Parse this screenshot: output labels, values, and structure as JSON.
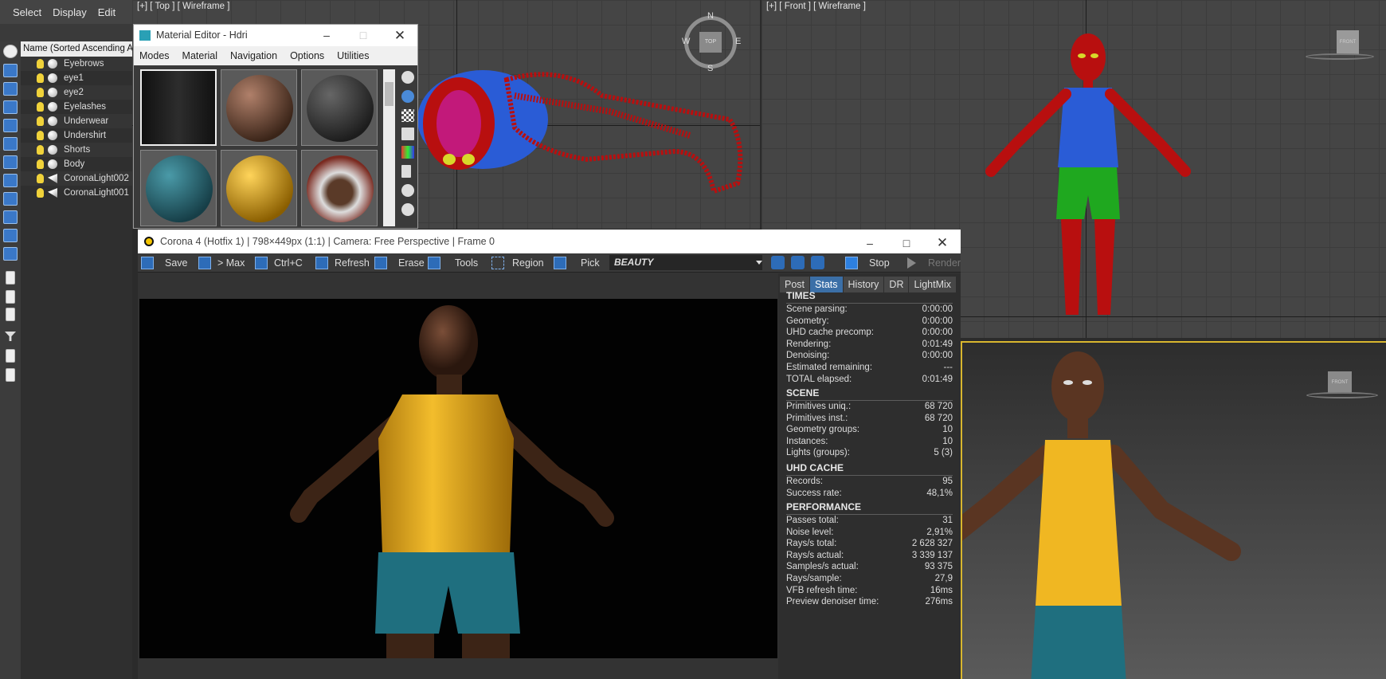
{
  "menubar": {
    "items": [
      "Select",
      "Display",
      "Edit"
    ]
  },
  "explorer": {
    "header": "Name (Sorted Ascending Ag",
    "items": [
      {
        "label": "Eyebrows",
        "kind": "object"
      },
      {
        "label": "eye1",
        "kind": "object"
      },
      {
        "label": "eye2",
        "kind": "object"
      },
      {
        "label": "Eyelashes",
        "kind": "object"
      },
      {
        "label": "Underwear",
        "kind": "object"
      },
      {
        "label": "Undershirt",
        "kind": "object"
      },
      {
        "label": "Shorts",
        "kind": "object"
      },
      {
        "label": "Body",
        "kind": "object"
      },
      {
        "label": "CoronaLight002",
        "kind": "light"
      },
      {
        "label": "CoronaLight001",
        "kind": "light"
      }
    ]
  },
  "viewports": {
    "top": {
      "label": "[+] [ Top ] [ Wireframe ]",
      "compass": {
        "n": "N",
        "s": "S",
        "e": "E",
        "w": "W",
        "cube": "TOP"
      }
    },
    "front": {
      "label": "[+] [ Front ] [ Wireframe ]",
      "cube": "FRONT"
    },
    "persp": {
      "cube": "FRONT"
    }
  },
  "material_editor": {
    "title": "Material Editor - Hdri",
    "menu": [
      "Modes",
      "Material",
      "Navigation",
      "Options",
      "Utilities"
    ]
  },
  "corona": {
    "title": "Corona 4 (Hotfix 1) | 798×449px (1:1) | Camera: Free Perspective | Frame 0",
    "toolbar": {
      "save": "Save",
      "max": "> Max",
      "copy": "Ctrl+C",
      "refresh": "Refresh",
      "erase": "Erase",
      "tools": "Tools",
      "region": "Region",
      "pick": "Pick",
      "pass": "BEAUTY",
      "stop": "Stop",
      "render": "Render"
    },
    "tabs": [
      "Post",
      "Stats",
      "History",
      "DR",
      "LightMix"
    ],
    "active_tab": "Stats",
    "stats": {
      "times": {
        "title": "TIMES",
        "rows": [
          [
            "Scene parsing:",
            "0:00:00"
          ],
          [
            "Geometry:",
            "0:00:00"
          ],
          [
            "UHD cache precomp:",
            "0:00:00"
          ],
          [
            "Rendering:",
            "0:01:49"
          ],
          [
            "Denoising:",
            "0:00:00"
          ],
          [
            "Estimated remaining:",
            "---"
          ],
          [
            "TOTAL elapsed:",
            "0:01:49"
          ]
        ]
      },
      "scene": {
        "title": "SCENE",
        "rows": [
          [
            "Primitives uniq.:",
            "68 720"
          ],
          [
            "Primitives inst.:",
            "68 720"
          ],
          [
            "Geometry groups:",
            "10"
          ],
          [
            "Instances:",
            "10"
          ],
          [
            "Lights (groups):",
            "5 (3)"
          ]
        ]
      },
      "uhd": {
        "title": "UHD CACHE",
        "rows": [
          [
            "Records:",
            "95"
          ],
          [
            "Success rate:",
            "48,1%"
          ]
        ]
      },
      "perf": {
        "title": "PERFORMANCE",
        "rows": [
          [
            "Passes total:",
            "31"
          ],
          [
            "Noise level:",
            "2,91%"
          ],
          [
            "Rays/s total:",
            "2 628 327"
          ],
          [
            "Rays/s actual:",
            "3 339 137"
          ],
          [
            "Samples/s actual:",
            "93 375"
          ],
          [
            "Rays/sample:",
            "27,9"
          ],
          [
            "VFB refresh time:",
            "16ms"
          ],
          [
            "Preview denoiser time:",
            "276ms"
          ]
        ]
      }
    }
  },
  "colors": {
    "accent": "#3b6fa7",
    "wire_red": "#b80f0f",
    "wire_blue": "#2a5cd6",
    "wire_green": "#1fa81f",
    "shirt": "#f0b722",
    "shorts": "#1f6f7f"
  }
}
